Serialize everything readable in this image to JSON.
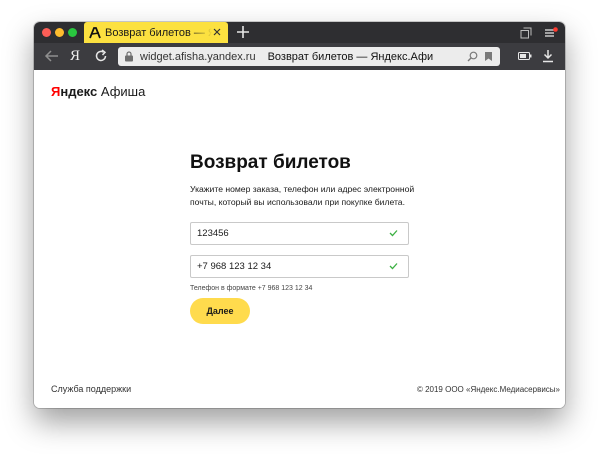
{
  "browser": {
    "tab": {
      "title": "Возврат билетов — Яндекс.Афиша"
    },
    "address_bar": {
      "domain": "widget.afisha.yandex.ru",
      "page_title": "Возврат билетов — Яндекс.Афи"
    },
    "toolbar_logo": "Я"
  },
  "page": {
    "logo": {
      "yandex_first": "Я",
      "yandex_rest": "ндекс",
      "afisha": "Афиша"
    },
    "form": {
      "title": "Возврат билетов",
      "description": "Укажите номер заказа, телефон или адрес электронной почты, который вы использовали при покупке билета.",
      "order_field": {
        "value": "123456",
        "valid": true
      },
      "phone_field": {
        "value": "+7 968 123 12 34",
        "valid": true
      },
      "phone_hint": "Телефон в формате +7 968 123 12 34",
      "submit_label": "Далее"
    },
    "footer": {
      "support_link": "Служба поддержки",
      "copyright": "© 2019 ООО «Яндекс.Медиасервисы»"
    }
  },
  "colors": {
    "accent_yellow": "#ffdb4d",
    "tab_yellow": "#fce140",
    "valid_check": "#3cb043",
    "logo_red": "#ff0000"
  }
}
